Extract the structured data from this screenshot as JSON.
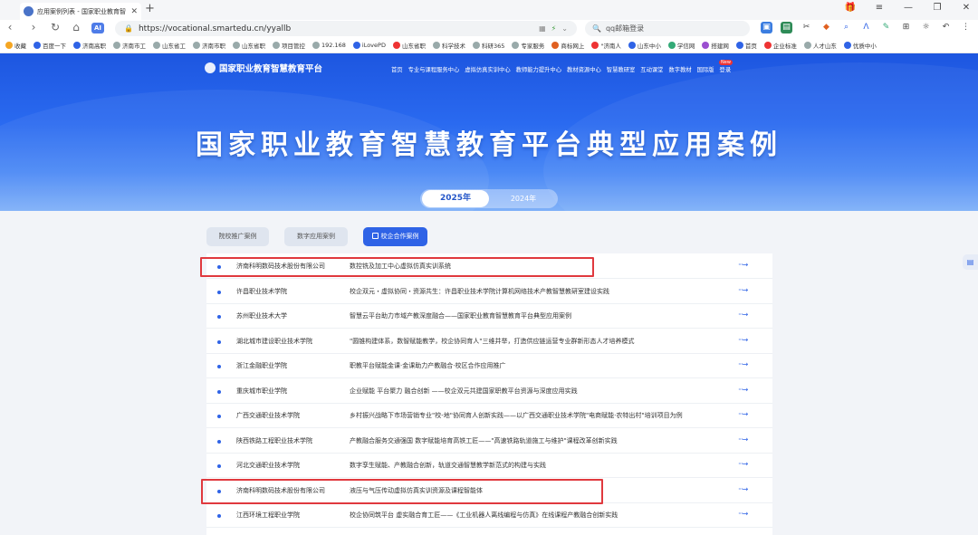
{
  "browser": {
    "tab_title": "应用案例列表 - 国家职业教育智",
    "url": "https://vocational.smartedu.cn/yyallb",
    "search_text": "qq邮箱登录",
    "ai_label": "AI"
  },
  "bookmarks": [
    "收藏",
    "百度一下",
    "济南高职",
    "济南市工",
    "山东省工",
    "济南市职",
    "山东省职",
    "项目管控",
    "192.168",
    "iLovePD",
    "山东省职",
    "科学技术",
    "科研365",
    "专家服务",
    "商标网上",
    "\"济南人",
    "山东中小",
    "学信网",
    "搭建网",
    "首页",
    "企业标准",
    "人才山东",
    "优质中小"
  ],
  "site": {
    "logo_text": "国家职业教育智慧教育平台",
    "nav": [
      "首页",
      "专业与课程服务中心",
      "虚拟仿真实训中心",
      "教师能力提升中心",
      "教材资源中心",
      "智慧教研室",
      "互动课堂",
      "数字教材",
      "国际版",
      "登录"
    ],
    "new_badge": "New",
    "hero_title": "国家职业教育智慧教育平台典型应用案例",
    "years": [
      "2025年",
      "2024年"
    ]
  },
  "categories": [
    "院校推广案例",
    "数字应用案例",
    "校企合作案例"
  ],
  "cases": [
    {
      "org": "济南科明数码技术股份有限公司",
      "title": "数控铣及加工中心虚拟仿真实训系统"
    },
    {
      "org": "许昌职业技术学院",
      "title": "校企双元・虚拟协同・资源共生：许昌职业技术学院计算机网络技术产教智慧教研室建设实践"
    },
    {
      "org": "苏州职业技术大学",
      "title": "智慧云平台助力市域产教深度融合——国家职业教育智慧教育平台典型应用案例"
    },
    {
      "org": "湖北城市建设职业技术学院",
      "title": "\"圆锥构建体系，数智赋能教学，校企协同育人\"三维并举，打造供应链运营专业群新形态人才培养模式"
    },
    {
      "org": "浙江金融职业学院",
      "title": "职教平台赋能金课·金课助力产教融合·校区合作应用推广"
    },
    {
      "org": "重庆城市职业学院",
      "title": "企业赋能 平台聚力 融合创新 ——校企双元共建国家职教平台资源与深度应用实践"
    },
    {
      "org": "广西交通职业技术学院",
      "title": "乡村振兴战略下市场营销专业\"校-地\"协同育人创新实践——以广西交通职业技术学院\"电商赋能·农特出村\"培训项目为例"
    },
    {
      "org": "陕西铁路工程职业技术学院",
      "title": "产教融合服务交通强国 数字赋能培育高铁工匠——\"高速铁路轨道施工与维护\"课程改革创新实践"
    },
    {
      "org": "河北交通职业技术学院",
      "title": "数字孪生赋能、产教融合创新，轨道交通智慧教学新范式的构建与实践"
    },
    {
      "org": "济南科明数码技术股份有限公司",
      "title": "液压与气压传动虚拟仿真实训资源及课程智能体"
    },
    {
      "org": "江西环境工程职业学院",
      "title": "校企协同筑平台 虚实融合育工匠——《工业机器人离线编程与仿真》在线课程产教融合创新实践"
    }
  ],
  "more_symbol": "···→"
}
